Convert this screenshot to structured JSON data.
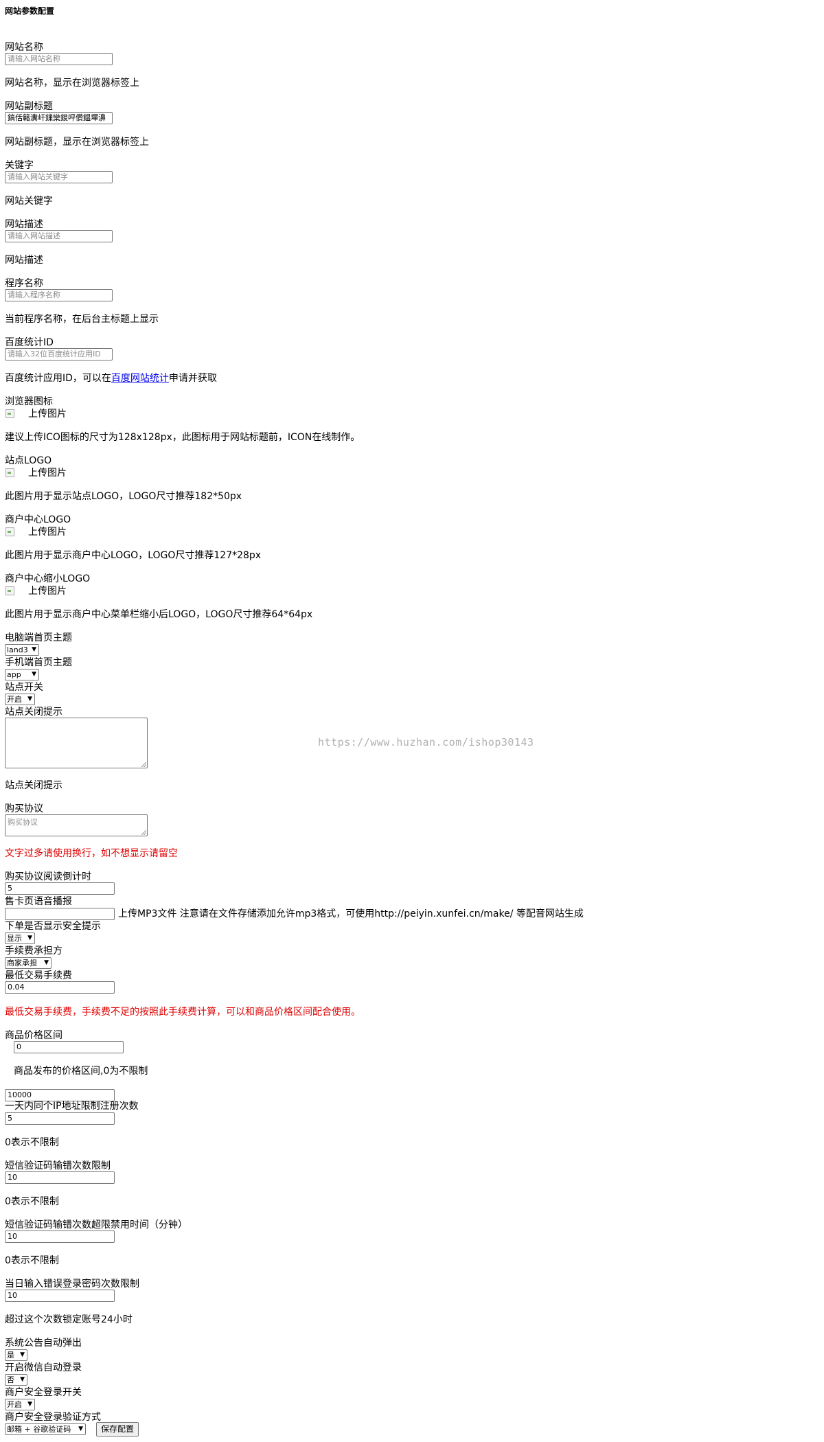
{
  "page_title": "网站参数配置",
  "fields": {
    "site_name": {
      "label": "网站名称",
      "placeholder": "请输入网站名称",
      "hint": "网站名称，显示在浏览器标签上"
    },
    "site_subtitle": {
      "label": "网站副标题",
      "value": "鎬佸簵瀵屽鏁欒鍐呯儹鎾墠濞",
      "hint": "网站副标题，显示在浏览器标签上"
    },
    "keywords": {
      "label": "关键字",
      "placeholder": "请输入网站关键字",
      "hint": "网站关键字"
    },
    "description": {
      "label": "网站描述",
      "placeholder": "请输入网站描述",
      "hint": "网站描述"
    },
    "program_name": {
      "label": "程序名称",
      "placeholder": "请输入程序名称",
      "hint": "当前程序名称，在后台主标题上显示"
    },
    "baidu_id": {
      "label": "百度统计ID",
      "placeholder": "请输入32位百度统计应用ID",
      "hint_before": "百度统计应用ID，可以在",
      "hint_link": "百度网站统计",
      "hint_after": "申请并获取"
    },
    "favicon": {
      "label": "浏览器图标",
      "upload": "上传图片",
      "hint": "建议上传ICO图标的尺寸为128x128px，此图标用于网站标题前，ICON在线制作。"
    },
    "site_logo": {
      "label": "站点LOGO",
      "upload": "上传图片",
      "hint": "此图片用于显示站点LOGO，LOGO尺寸推荐182*50px"
    },
    "merchant_logo": {
      "label": "商户中心LOGO",
      "upload": "上传图片",
      "hint": "此图片用于显示商户中心LOGO，LOGO尺寸推荐127*28px"
    },
    "merchant_small_logo": {
      "label": "商户中心缩小LOGO",
      "upload": "上传图片",
      "hint": "此图片用于显示商户中心菜单栏缩小后LOGO，LOGO尺寸推荐64*64px"
    },
    "pc_theme": {
      "label": "电脑端首页主题",
      "selected": "land3"
    },
    "mobile_theme": {
      "label": "手机端首页主题",
      "selected": "app"
    },
    "site_switch": {
      "label": "站点开关",
      "selected": "开启"
    },
    "close_tip": {
      "label": "站点关闭提示",
      "hint": "站点关闭提示"
    },
    "agreement": {
      "label": "购买协议",
      "placeholder": "购买协议",
      "hint": "文字过多请使用换行，如不想显示请留空"
    },
    "agreement_countdown": {
      "label": "购买协议阅读倒计时",
      "value": "5"
    },
    "voice": {
      "label": "售卡页语音播报",
      "value": "",
      "hint": "上传MP3文件 注意请在文件存储添加允许mp3格式，可使用http://peiyin.xunfei.cn/make/ 等配音网站生成"
    },
    "safety_tip": {
      "label": "下单是否显示安全提示",
      "selected": "显示"
    },
    "fee_payer": {
      "label": "手续费承担方",
      "selected": "商家承担"
    },
    "min_fee": {
      "label": "最低交易手续费",
      "value": "0.04",
      "hint": "最低交易手续费，手续费不足的按照此手续费计算，可以和商品价格区间配合使用。"
    },
    "price_range": {
      "label": "商品价格区间",
      "min": "0",
      "hint": "商品发布的价格区间,0为不限制",
      "max": "10000"
    },
    "ip_limit": {
      "label": "一天内同个IP地址限制注册次数",
      "value": "5",
      "hint": "0表示不限制"
    },
    "sms_error_limit": {
      "label": "短信验证码输错次数限制",
      "value": "10",
      "hint": "0表示不限制"
    },
    "sms_ban_time": {
      "label": "短信验证码输错次数超限禁用时间（分钟）",
      "value": "10",
      "hint": "0表示不限制"
    },
    "login_error_limit": {
      "label": "当日输入错误登录密码次数限制",
      "value": "10",
      "hint": "超过这个次数锁定账号24小时"
    },
    "notice_popup": {
      "label": "系统公告自动弹出",
      "selected": "是"
    },
    "wechat_login": {
      "label": "开启微信自动登录",
      "selected": "否"
    },
    "secure_login": {
      "label": "商户安全登录开关",
      "selected": "开启"
    },
    "secure_login_method": {
      "label": "商户安全登录验证方式",
      "selected": "邮箱 + 谷歌验证码"
    }
  },
  "save_button": "保存配置",
  "watermark": "https://www.huzhan.com/ishop30143"
}
